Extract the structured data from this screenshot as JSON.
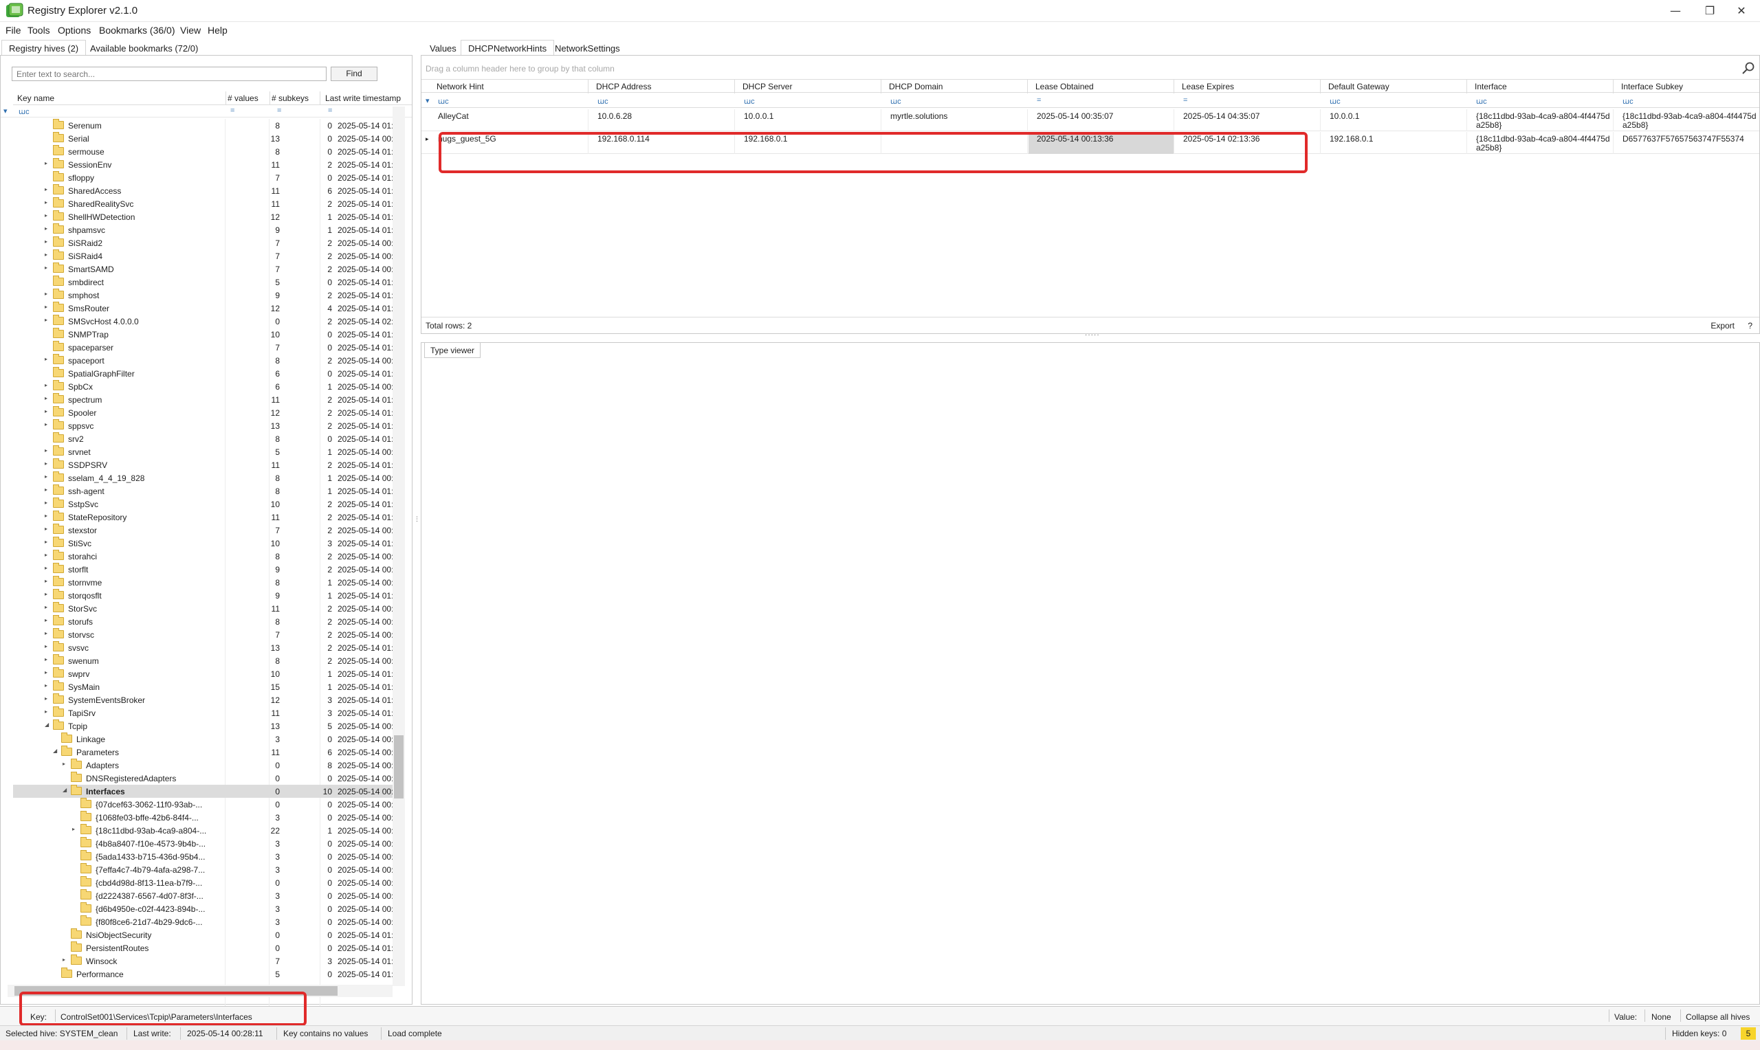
{
  "window": {
    "title": "Registry Explorer v2.1.0",
    "controls": {
      "minimize": "—",
      "restore": "❐",
      "close": "✕"
    }
  },
  "menu": [
    "File",
    "Tools",
    "Options",
    "Bookmarks (36/0)",
    "View",
    "Help"
  ],
  "left_tabs": [
    "Registry hives (2)",
    "Available bookmarks (72/0)"
  ],
  "search": {
    "placeholder": "Enter text to search...",
    "find_label": "Find"
  },
  "tree": {
    "columns": [
      "Key name",
      "# values",
      "# subkeys",
      "Last write timestamp"
    ],
    "filter_symbols": {
      "name": "ꭐc",
      "eq": "="
    },
    "rows": [
      {
        "name": "Serenum",
        "values": "8",
        "subkeys": "0",
        "ts": "2025-05-14 01:1",
        "depth": 0,
        "exp": ""
      },
      {
        "name": "Serial",
        "values": "13",
        "subkeys": "0",
        "ts": "2025-05-14 00:2",
        "depth": 0,
        "exp": ""
      },
      {
        "name": "sermouse",
        "values": "8",
        "subkeys": "0",
        "ts": "2025-05-14 01:1",
        "depth": 0,
        "exp": ""
      },
      {
        "name": "SessionEnv",
        "values": "11",
        "subkeys": "2",
        "ts": "2025-05-14 01:1",
        "depth": 0,
        "exp": "▸"
      },
      {
        "name": "sfloppy",
        "values": "7",
        "subkeys": "0",
        "ts": "2025-05-14 01:1",
        "depth": 0,
        "exp": ""
      },
      {
        "name": "SharedAccess",
        "values": "11",
        "subkeys": "6",
        "ts": "2025-05-14 01:1",
        "depth": 0,
        "exp": "▸"
      },
      {
        "name": "SharedRealitySvc",
        "values": "11",
        "subkeys": "2",
        "ts": "2025-05-14 01:1",
        "depth": 0,
        "exp": "▸"
      },
      {
        "name": "ShellHWDetection",
        "values": "12",
        "subkeys": "1",
        "ts": "2025-05-14 01:1",
        "depth": 0,
        "exp": "▸"
      },
      {
        "name": "shpamsvc",
        "values": "9",
        "subkeys": "1",
        "ts": "2025-05-14 01:1",
        "depth": 0,
        "exp": "▸"
      },
      {
        "name": "SiSRaid2",
        "values": "7",
        "subkeys": "2",
        "ts": "2025-05-14 00:2",
        "depth": 0,
        "exp": "▸"
      },
      {
        "name": "SiSRaid4",
        "values": "7",
        "subkeys": "2",
        "ts": "2025-05-14 00:2",
        "depth": 0,
        "exp": "▸"
      },
      {
        "name": "SmartSAMD",
        "values": "7",
        "subkeys": "2",
        "ts": "2025-05-14 00:2",
        "depth": 0,
        "exp": "▸"
      },
      {
        "name": "smbdirect",
        "values": "5",
        "subkeys": "0",
        "ts": "2025-05-14 01:1",
        "depth": 0,
        "exp": ""
      },
      {
        "name": "smphost",
        "values": "9",
        "subkeys": "2",
        "ts": "2025-05-14 01:1",
        "depth": 0,
        "exp": "▸"
      },
      {
        "name": "SmsRouter",
        "values": "12",
        "subkeys": "4",
        "ts": "2025-05-14 01:1",
        "depth": 0,
        "exp": "▸"
      },
      {
        "name": "SMSvcHost 4.0.0.0",
        "values": "0",
        "subkeys": "2",
        "ts": "2025-05-14 02:2",
        "depth": 0,
        "exp": "▸"
      },
      {
        "name": "SNMPTrap",
        "values": "10",
        "subkeys": "0",
        "ts": "2025-05-14 01:1",
        "depth": 0,
        "exp": ""
      },
      {
        "name": "spaceparser",
        "values": "7",
        "subkeys": "0",
        "ts": "2025-05-14 01:1",
        "depth": 0,
        "exp": ""
      },
      {
        "name": "spaceport",
        "values": "8",
        "subkeys": "2",
        "ts": "2025-05-14 00:1",
        "depth": 0,
        "exp": "▸"
      },
      {
        "name": "SpatialGraphFilter",
        "values": "6",
        "subkeys": "0",
        "ts": "2025-05-14 01:1",
        "depth": 0,
        "exp": ""
      },
      {
        "name": "SpbCx",
        "values": "6",
        "subkeys": "1",
        "ts": "2025-05-14 00:2",
        "depth": 0,
        "exp": "▸"
      },
      {
        "name": "spectrum",
        "values": "11",
        "subkeys": "2",
        "ts": "2025-05-14 01:1",
        "depth": 0,
        "exp": "▸"
      },
      {
        "name": "Spooler",
        "values": "12",
        "subkeys": "2",
        "ts": "2025-05-14 01:1",
        "depth": 0,
        "exp": "▸"
      },
      {
        "name": "sppsvc",
        "values": "13",
        "subkeys": "2",
        "ts": "2025-05-14 01:1",
        "depth": 0,
        "exp": "▸"
      },
      {
        "name": "srv2",
        "values": "8",
        "subkeys": "0",
        "ts": "2025-05-14 01:1",
        "depth": 0,
        "exp": ""
      },
      {
        "name": "srvnet",
        "values": "5",
        "subkeys": "1",
        "ts": "2025-05-14 00:1",
        "depth": 0,
        "exp": "▸"
      },
      {
        "name": "SSDPSRV",
        "values": "11",
        "subkeys": "2",
        "ts": "2025-05-14 01:1",
        "depth": 0,
        "exp": "▸"
      },
      {
        "name": "sselam_4_4_19_828",
        "values": "8",
        "subkeys": "1",
        "ts": "2025-05-14 00:4",
        "depth": 0,
        "exp": "▸"
      },
      {
        "name": "ssh-agent",
        "values": "8",
        "subkeys": "1",
        "ts": "2025-05-14 01:1",
        "depth": 0,
        "exp": "▸"
      },
      {
        "name": "SstpSvc",
        "values": "10",
        "subkeys": "2",
        "ts": "2025-05-14 01:1",
        "depth": 0,
        "exp": "▸"
      },
      {
        "name": "StateRepository",
        "values": "11",
        "subkeys": "2",
        "ts": "2025-05-14 01:1",
        "depth": 0,
        "exp": "▸"
      },
      {
        "name": "stexstor",
        "values": "7",
        "subkeys": "2",
        "ts": "2025-05-14 00:2",
        "depth": 0,
        "exp": "▸"
      },
      {
        "name": "StiSvc",
        "values": "10",
        "subkeys": "3",
        "ts": "2025-05-14 01:1",
        "depth": 0,
        "exp": "▸"
      },
      {
        "name": "storahci",
        "values": "8",
        "subkeys": "2",
        "ts": "2025-05-14 00:2",
        "depth": 0,
        "exp": "▸"
      },
      {
        "name": "storflt",
        "values": "9",
        "subkeys": "2",
        "ts": "2025-05-14 00:2",
        "depth": 0,
        "exp": "▸"
      },
      {
        "name": "stornvme",
        "values": "8",
        "subkeys": "1",
        "ts": "2025-05-14 00:1",
        "depth": 0,
        "exp": "▸"
      },
      {
        "name": "storqosflt",
        "values": "9",
        "subkeys": "1",
        "ts": "2025-05-14 01:1",
        "depth": 0,
        "exp": "▸"
      },
      {
        "name": "StorSvc",
        "values": "11",
        "subkeys": "2",
        "ts": "2025-05-14 00:1",
        "depth": 0,
        "exp": "▸"
      },
      {
        "name": "storufs",
        "values": "8",
        "subkeys": "2",
        "ts": "2025-05-14 00:1",
        "depth": 0,
        "exp": "▸"
      },
      {
        "name": "storvsc",
        "values": "7",
        "subkeys": "2",
        "ts": "2025-05-14 00:2",
        "depth": 0,
        "exp": "▸"
      },
      {
        "name": "svsvc",
        "values": "13",
        "subkeys": "2",
        "ts": "2025-05-14 01:1",
        "depth": 0,
        "exp": "▸"
      },
      {
        "name": "swenum",
        "values": "8",
        "subkeys": "2",
        "ts": "2025-05-14 00:1",
        "depth": 0,
        "exp": "▸"
      },
      {
        "name": "swprv",
        "values": "10",
        "subkeys": "1",
        "ts": "2025-05-14 01:1",
        "depth": 0,
        "exp": "▸"
      },
      {
        "name": "SysMain",
        "values": "15",
        "subkeys": "1",
        "ts": "2025-05-14 01:1",
        "depth": 0,
        "exp": "▸"
      },
      {
        "name": "SystemEventsBroker",
        "values": "12",
        "subkeys": "3",
        "ts": "2025-05-14 01:1",
        "depth": 0,
        "exp": "▸"
      },
      {
        "name": "TapiSrv",
        "values": "11",
        "subkeys": "3",
        "ts": "2025-05-14 01:1",
        "depth": 0,
        "exp": "▸"
      },
      {
        "name": "Tcpip",
        "values": "13",
        "subkeys": "5",
        "ts": "2025-05-14 00:2",
        "depth": 0,
        "exp": "◢"
      },
      {
        "name": "Linkage",
        "values": "3",
        "subkeys": "0",
        "ts": "2025-05-14 00:2",
        "depth": 1,
        "exp": ""
      },
      {
        "name": "Parameters",
        "values": "11",
        "subkeys": "6",
        "ts": "2025-05-14 00:3",
        "depth": 1,
        "exp": "◢"
      },
      {
        "name": "Adapters",
        "values": "0",
        "subkeys": "8",
        "ts": "2025-05-14 00:2",
        "depth": 2,
        "exp": "▸"
      },
      {
        "name": "DNSRegisteredAdapters",
        "values": "0",
        "subkeys": "0",
        "ts": "2025-05-14 00:2",
        "depth": 2,
        "exp": ""
      },
      {
        "name": "Interfaces",
        "values": "0",
        "subkeys": "10",
        "ts": "2025-05-14 00:2",
        "depth": 2,
        "exp": "◢",
        "selected": true
      },
      {
        "name": "{07dcef63-3062-11f0-93ab-...",
        "values": "0",
        "subkeys": "0",
        "ts": "2025-05-14 00:2",
        "depth": 3,
        "exp": ""
      },
      {
        "name": "{1068fe03-bffe-42b6-84f4-...",
        "values": "3",
        "subkeys": "0",
        "ts": "2025-05-14 00:2",
        "depth": 3,
        "exp": ""
      },
      {
        "name": "{18c11dbd-93ab-4ca9-a804-...",
        "values": "22",
        "subkeys": "1",
        "ts": "2025-05-14 00:3",
        "depth": 3,
        "exp": "▸"
      },
      {
        "name": "{4b8a8407-f10e-4573-9b4b-...",
        "values": "3",
        "subkeys": "0",
        "ts": "2025-05-14 00:2",
        "depth": 3,
        "exp": ""
      },
      {
        "name": "{5ada1433-b715-436d-95b4...",
        "values": "3",
        "subkeys": "0",
        "ts": "2025-05-14 00:2",
        "depth": 3,
        "exp": ""
      },
      {
        "name": "{7effa4c7-4b79-4afa-a298-7...",
        "values": "3",
        "subkeys": "0",
        "ts": "2025-05-14 00:2",
        "depth": 3,
        "exp": ""
      },
      {
        "name": "{cbd4d98d-8f13-11ea-b7f9-...",
        "values": "0",
        "subkeys": "0",
        "ts": "2025-05-14 00:2",
        "depth": 3,
        "exp": ""
      },
      {
        "name": "{d2224387-6567-4d07-8f3f-...",
        "values": "3",
        "subkeys": "0",
        "ts": "2025-05-14 00:2",
        "depth": 3,
        "exp": ""
      },
      {
        "name": "{d6b4950e-c02f-4423-894b-...",
        "values": "3",
        "subkeys": "0",
        "ts": "2025-05-14 00:2",
        "depth": 3,
        "exp": ""
      },
      {
        "name": "{f80f8ce6-21d7-4b29-9dc6-...",
        "values": "3",
        "subkeys": "0",
        "ts": "2025-05-14 00:2",
        "depth": 3,
        "exp": ""
      },
      {
        "name": "NsiObjectSecurity",
        "values": "0",
        "subkeys": "0",
        "ts": "2025-05-14 01:1",
        "depth": 2,
        "exp": ""
      },
      {
        "name": "PersistentRoutes",
        "values": "0",
        "subkeys": "0",
        "ts": "2025-05-14 01:1",
        "depth": 2,
        "exp": ""
      },
      {
        "name": "Winsock",
        "values": "7",
        "subkeys": "3",
        "ts": "2025-05-14 01:1",
        "depth": 2,
        "exp": "▸"
      },
      {
        "name": "Performance",
        "values": "5",
        "subkeys": "0",
        "ts": "2025-05-14 01:1",
        "depth": 1,
        "exp": ""
      }
    ]
  },
  "right_tabs": [
    "Values",
    "DHCPNetworkHints",
    "NetworkSettings"
  ],
  "grid": {
    "group_hint": "Drag a column header here to group by that column",
    "columns": [
      "Network Hint",
      "DHCP Address",
      "DHCP Server",
      "DHCP Domain",
      "Lease Obtained",
      "Lease Expires",
      "Default Gateway",
      "Interface",
      "Interface Subkey"
    ],
    "filter_symbols": [
      "ꭐc",
      "ꭐc",
      "ꭐc",
      "ꭐc",
      "=",
      "=",
      "ꭐc",
      "ꭐc",
      "ꭐc"
    ],
    "rows": [
      [
        "AlleyCat",
        "10.0.6.28",
        "10.0.0.1",
        "myrtle.solutions",
        "2025-05-14 00:35:07",
        "2025-05-14 04:35:07",
        "10.0.0.1",
        "{18c11dbd-93ab-4ca9-a804-4f4475da25b8}",
        "{18c11dbd-93ab-4ca9-a804-4f4475da25b8}"
      ],
      [
        "nugs_guest_5G",
        "192.168.0.114",
        "192.168.0.1",
        "",
        "2025-05-14 00:13:36",
        "2025-05-14 02:13:36",
        "192.168.0.1",
        "{18c11dbd-93ab-4ca9-a804-4f4475da25b8}",
        "D6577637F57657563747F55374"
      ]
    ],
    "total_rows": "Total rows: 2",
    "export_label": "Export",
    "help_label": "?"
  },
  "type_viewer_tab": "Type viewer",
  "keybar": {
    "key_label": "Key:",
    "key_path": "ControlSet001\\Services\\Tcpip\\Parameters\\Interfaces",
    "value_label": "Value:",
    "value_text": "None",
    "collapse_label": "Collapse all hives"
  },
  "status": {
    "selected_hive": "Selected hive: SYSTEM_clean",
    "last_write_label": "Last write:",
    "last_write": "2025-05-14 00:28:11",
    "key_values": "Key contains no values",
    "load": "Load complete",
    "hidden_keys": "Hidden keys: 0",
    "hidden_count": "5"
  },
  "colors": {
    "annotation": "#e02a2a",
    "folder": "#f7d774",
    "selection": "#dcdcdc"
  },
  "icons": [
    "app-icon",
    "folder-icon",
    "search-icon",
    "filter-icon"
  ]
}
